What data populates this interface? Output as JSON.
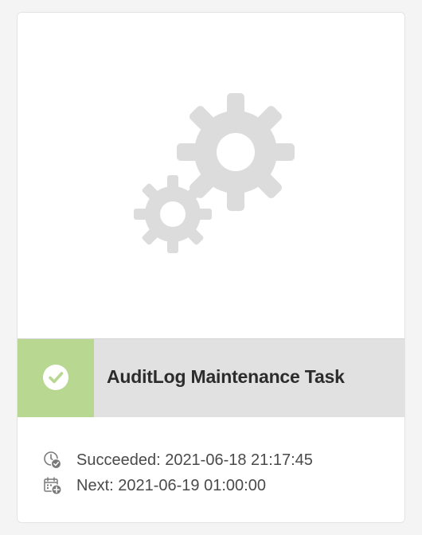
{
  "card": {
    "title": "AuditLog Maintenance Task",
    "status": "succeeded",
    "status_color": "#b8d891",
    "thumbnail_icon": "gears-icon",
    "meta": {
      "succeeded_text": "Succeeded: 2021-06-18 21:17:45",
      "succeeded_icon": "clock-check-icon",
      "next_text": "Next: 2021-06-19 01:00:00",
      "next_icon": "calendar-add-icon"
    }
  }
}
